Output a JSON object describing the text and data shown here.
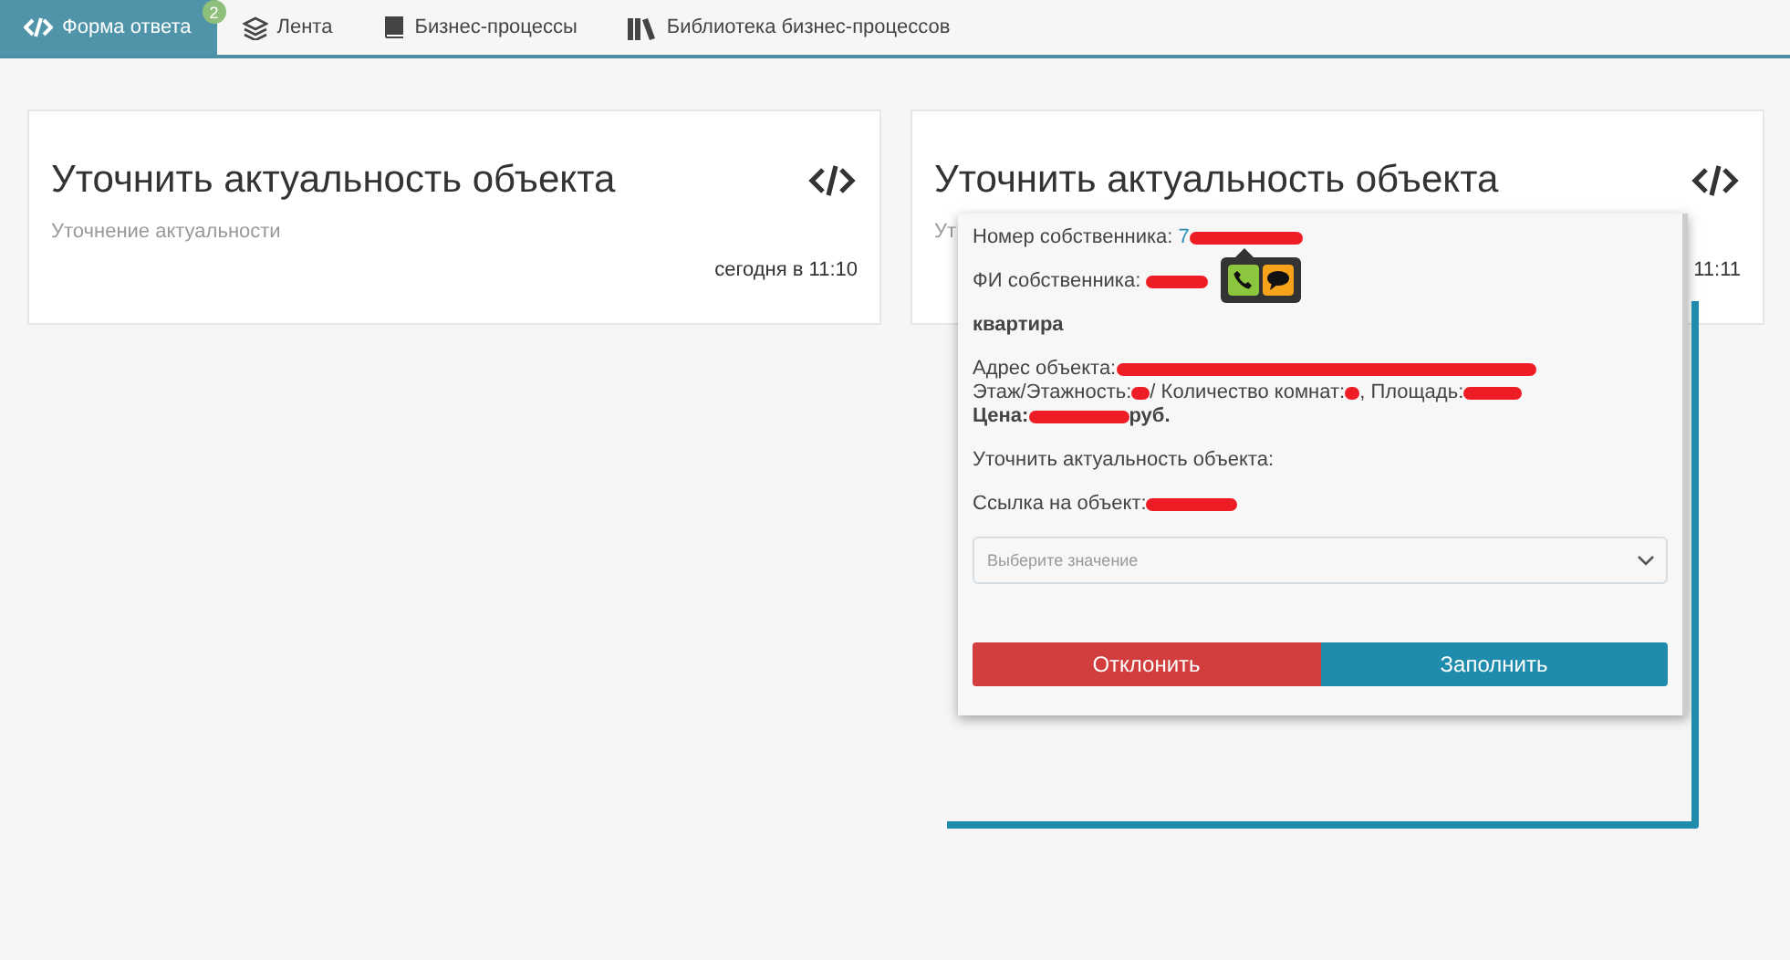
{
  "tabs": [
    {
      "label": "Форма ответа",
      "kind": "code",
      "selected": true,
      "badge": "2"
    },
    {
      "label": "Лента",
      "kind": "layers",
      "selected": false
    },
    {
      "label": "Бизнес-процессы",
      "kind": "book",
      "selected": false
    },
    {
      "label": "Библиотека бизнес-процессов",
      "kind": "library",
      "selected": false
    }
  ],
  "cards": [
    {
      "title": "Уточнить актуальность объекта",
      "subtitle": "Уточнение актуальности",
      "time": "сегодня в 11:10"
    },
    {
      "title": "Уточнить актуальность объекта",
      "subtitle": "Ут",
      "time": "11:11"
    }
  ],
  "popup": {
    "blocks": [
      [
        {
          "kind": "text",
          "parts": [
            {
              "kind": "text",
              "text": "Номер собственника: "
            },
            {
              "kind": "link",
              "text": "7"
            },
            {
              "kind": "redacted"
            }
          ]
        }
      ],
      [
        {
          "kind": "text",
          "parts": [
            {
              "kind": "text",
              "text": "ФИ собственника: "
            },
            {
              "kind": "redacted"
            }
          ],
          "contact_buttons": [
            {
              "kind": "phone"
            },
            {
              "kind": "chat"
            }
          ]
        }
      ],
      [
        {
          "kind": "bold",
          "parts": [
            {
              "kind": "text",
              "text": "квартира"
            }
          ]
        }
      ],
      [
        {
          "kind": "text",
          "parts": [
            {
              "kind": "text",
              "text": "Адрес объекта:"
            },
            {
              "kind": "redacted"
            }
          ]
        },
        {
          "kind": "text",
          "parts": [
            {
              "kind": "text",
              "text": "Этаж/Этажность:"
            },
            {
              "kind": "redacted"
            },
            {
              "kind": "text",
              "text": "/ Количество комнат:"
            },
            {
              "kind": "redacted"
            },
            {
              "kind": "text",
              "text": ", Площадь:"
            },
            {
              "kind": "redacted"
            }
          ]
        },
        {
          "kind": "bold",
          "parts": [
            {
              "kind": "text",
              "text": "Цена:"
            },
            {
              "kind": "redacted"
            },
            {
              "kind": "text",
              "text": "руб."
            }
          ]
        }
      ],
      [
        {
          "kind": "text",
          "parts": [
            {
              "kind": "text",
              "text": "Уточнить актуальность объекта:"
            }
          ]
        }
      ],
      [
        {
          "kind": "text",
          "parts": [
            {
              "kind": "text",
              "text": "Ссылка на объект:"
            },
            {
              "kind": "redacted"
            }
          ]
        }
      ]
    ],
    "select": {
      "placeholder": "Выберите значение"
    },
    "buttons": [
      {
        "label": "Отклонить",
        "kind": "danger"
      },
      {
        "label": "Заполнить",
        "kind": "primary"
      }
    ]
  }
}
